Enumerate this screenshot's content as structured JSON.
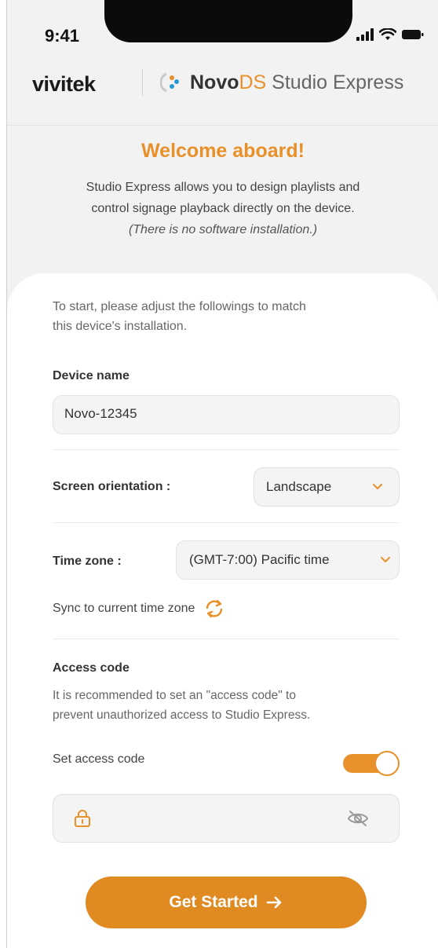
{
  "status_bar": {
    "time": "9:41"
  },
  "header": {
    "brand": "vivitek",
    "product_novo": "Novo",
    "product_ds": "DS",
    "product_suffix": " Studio Express"
  },
  "welcome": {
    "title": "Welcome aboard!",
    "line1": "Studio Express allows you to design playlists and",
    "line2": "control signage playback directly on the device.",
    "note": "(There is no software installation.)"
  },
  "form": {
    "intro_line1": "To start, please adjust the followings to match",
    "intro_line2": "this device's installation.",
    "device_name_label": "Device name",
    "device_name_value": "Novo-12345",
    "orientation_label": "Screen orientation :",
    "orientation_value": "Landscape",
    "timezone_label": "Time zone :",
    "timezone_value": "(GMT-7:00) Pacific time",
    "sync_label": "Sync to current time zone",
    "access_code_title": "Access code",
    "access_code_desc_line1": "It is recommended to set an \"access code\" to",
    "access_code_desc_line2": "prevent unauthorized access to Studio Express.",
    "set_access_code_label": "Set access code",
    "set_access_code_enabled": true,
    "access_code_value": ""
  },
  "cta": {
    "label": "Get Started"
  },
  "colors": {
    "accent": "#e8902a",
    "button": "#e08a22",
    "background": "#f2f2f2"
  },
  "icons": [
    "signal-icon",
    "wifi-icon",
    "battery-icon",
    "novo-logo-icon",
    "sync-icon",
    "chevron-down-icon",
    "lock-icon",
    "eye-off-icon",
    "arrow-right-icon"
  ]
}
